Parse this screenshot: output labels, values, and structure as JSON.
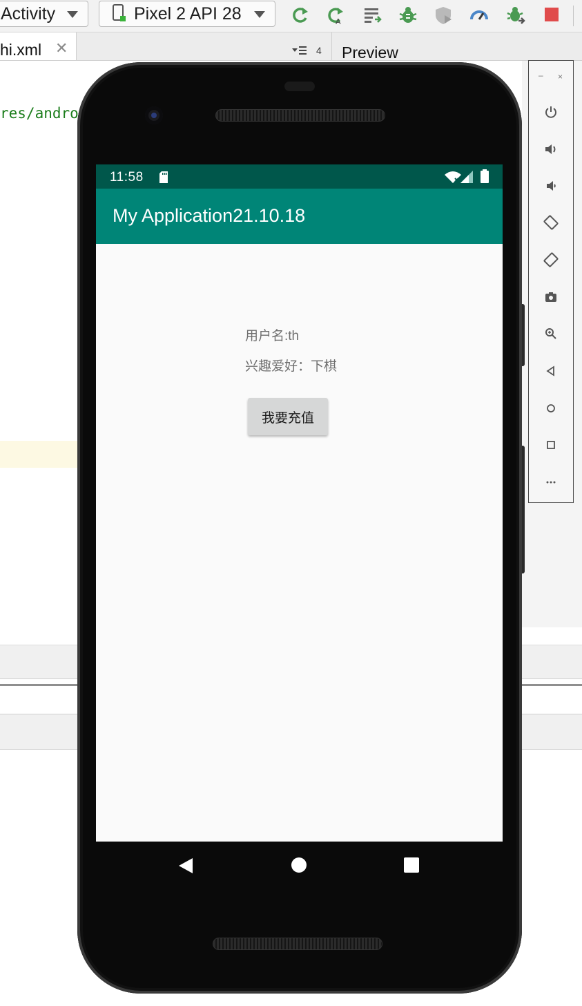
{
  "ide": {
    "config_combo": "Activity",
    "device_combo": "Pixel 2 API 28",
    "editor_tab": "hi.xml",
    "tab_close": "✕",
    "tab_overflow_count": "4",
    "preview_title": "Preview",
    "code_fragment": "res/andro"
  },
  "colors": {
    "status_bar": "#00574b",
    "app_bar": "#008577",
    "run_green": "#4a9a52",
    "stop_red": "#e04b4b"
  },
  "phone": {
    "status": {
      "time": "11:58"
    },
    "app_title": "My Application21.10.18",
    "content": {
      "username": "用户名:th",
      "hobby": "兴趣爱好：下棋",
      "button_label": "我要充值"
    }
  },
  "emulator_toolbar": {
    "minimize": "–",
    "close": "×",
    "buttons": [
      "power-icon",
      "volume-up-icon",
      "volume-down-icon",
      "rotate-left-icon",
      "rotate-right-icon",
      "camera-icon",
      "zoom-icon",
      "back-icon",
      "home-icon",
      "overview-icon",
      "more-icon"
    ]
  }
}
